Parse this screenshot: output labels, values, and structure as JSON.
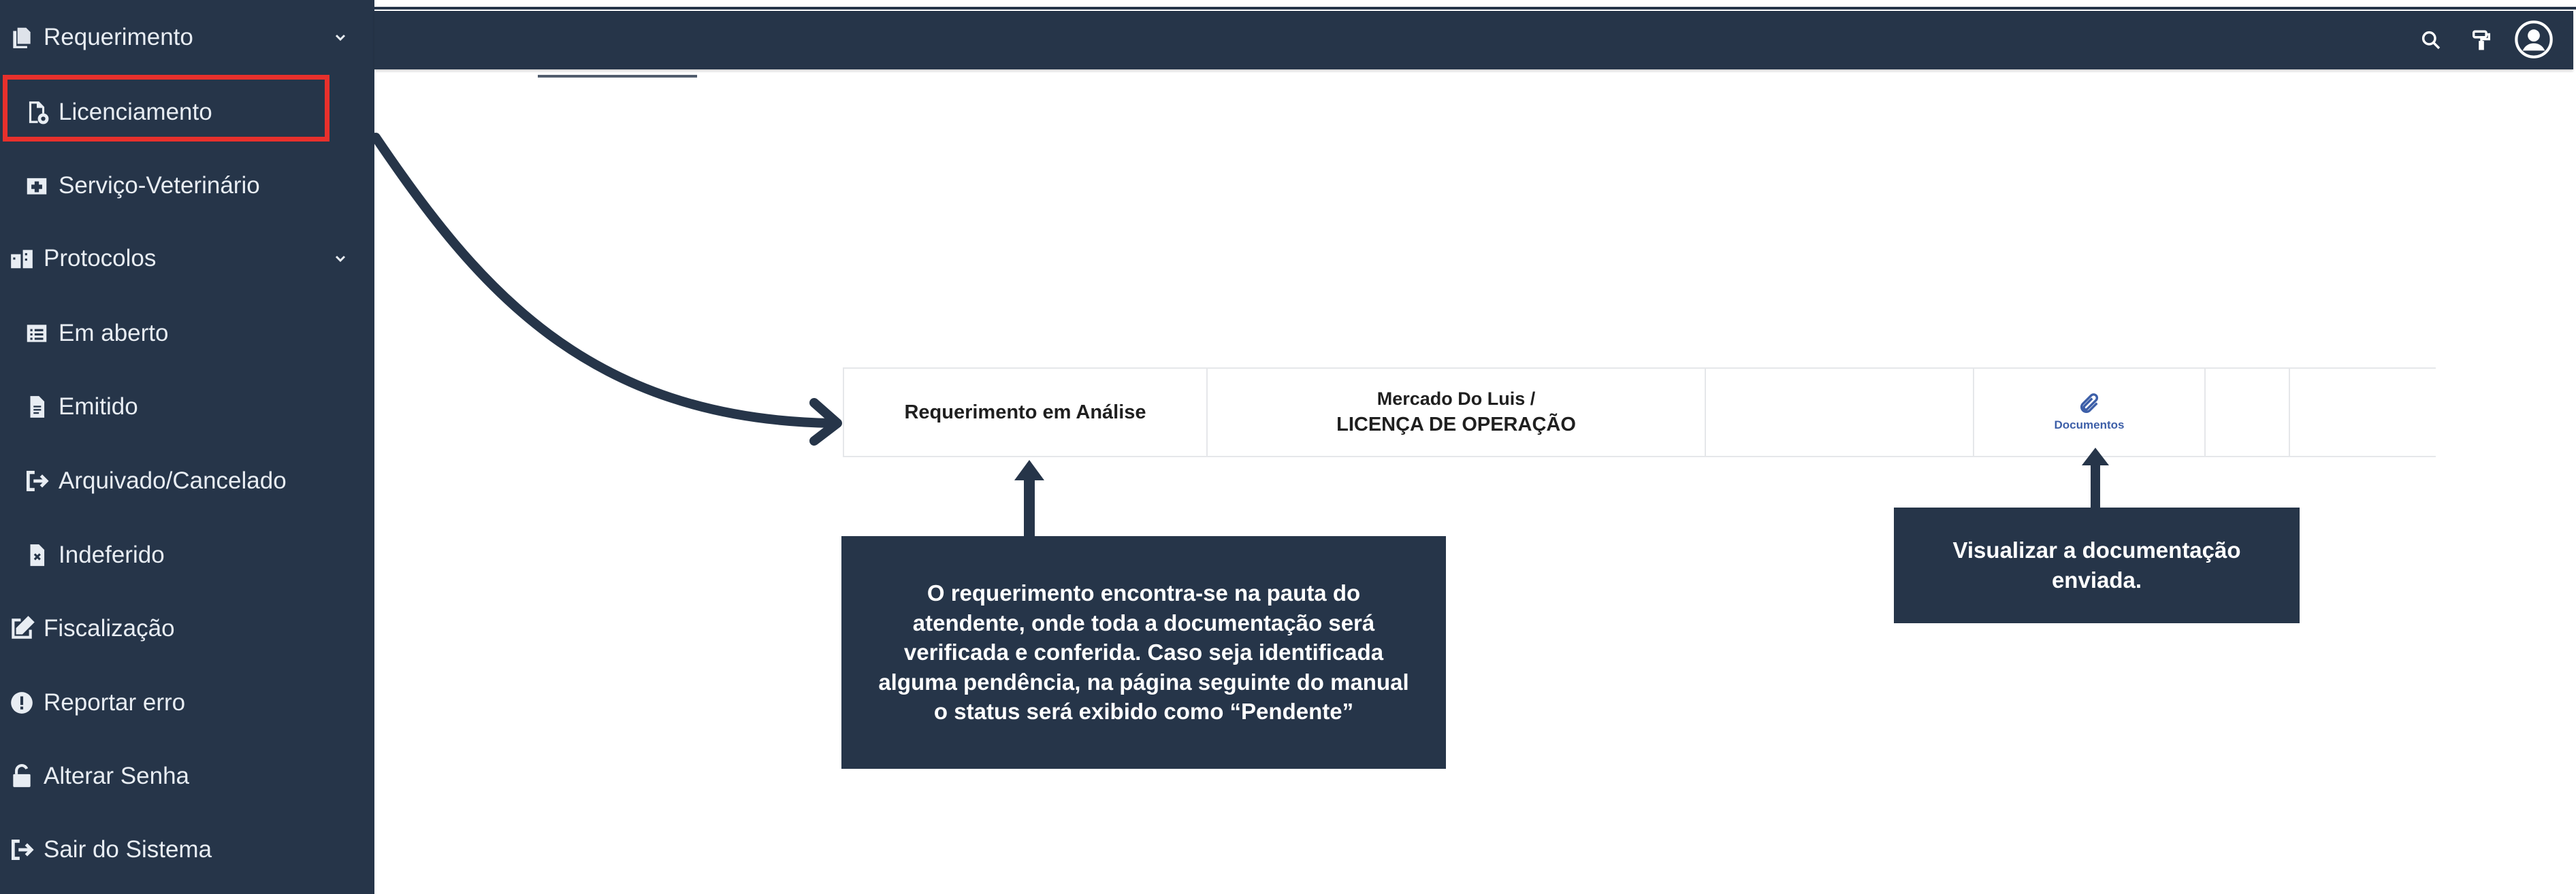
{
  "sidebar": {
    "items": [
      {
        "label": "Requerimento",
        "icon": "copy-icon",
        "expandable": true
      },
      {
        "label": "Licenciamento",
        "icon": "file-settings-icon",
        "highlighted": true
      },
      {
        "label": "Serviço-Veterinário",
        "icon": "medical-kit-icon"
      },
      {
        "label": "Protocolos",
        "icon": "building-icon",
        "expandable": true
      },
      {
        "label": "Em aberto",
        "icon": "list-icon"
      },
      {
        "label": "Emitido",
        "icon": "file-text-icon"
      },
      {
        "label": "Arquivado/Cancelado",
        "icon": "sign-out-icon"
      },
      {
        "label": "Indeferido",
        "icon": "file-x-icon"
      },
      {
        "label": "Fiscalização",
        "icon": "edit-icon"
      },
      {
        "label": "Reportar erro",
        "icon": "alert-circle-icon"
      },
      {
        "label": "Alterar Senha",
        "icon": "unlock-icon"
      },
      {
        "label": "Sair do Sistema",
        "icon": "sign-out-icon"
      }
    ]
  },
  "topbar": {
    "icons": [
      "search-icon",
      "paint-roller-icon",
      "user-avatar-icon"
    ]
  },
  "row": {
    "status": "Requerimento em Análise",
    "company": "Mercado Do Luis /",
    "license": "LICENÇA DE OPERAÇÃO",
    "documents_label": "Documentos"
  },
  "callouts": {
    "status_note": "O requerimento encontra-se na pauta do atendente, onde toda a documentação será verificada e conferida. Caso seja identificada alguma pendência, na página seguinte do manual o status será exibido como “Pendente”",
    "documents_note": "Visualizar a documentação enviada."
  },
  "colors": {
    "sidebar_bg": "#263549",
    "highlight": "#e8302c",
    "link": "#3d5fa8"
  }
}
